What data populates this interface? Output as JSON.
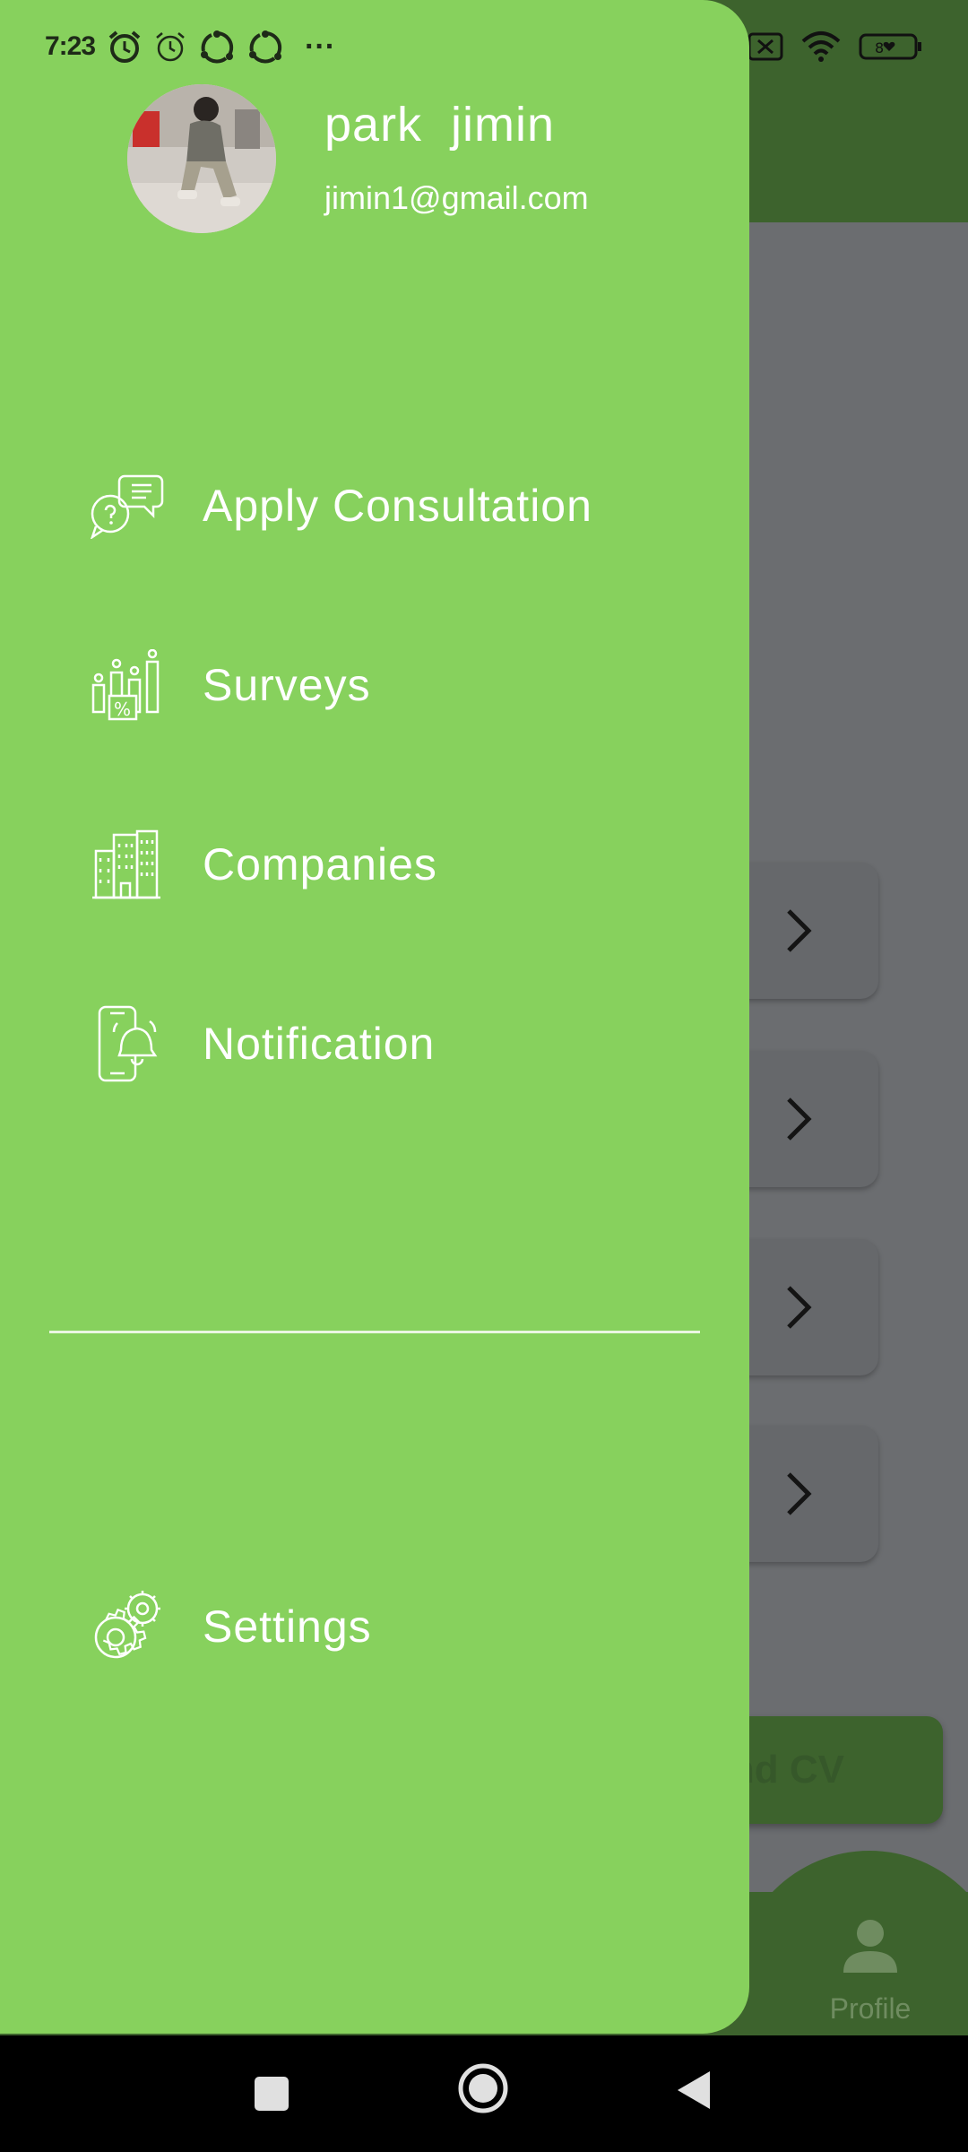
{
  "status_bar": {
    "time": "7:23",
    "more": "···",
    "battery": "80"
  },
  "drawer": {
    "user": {
      "name": "park  jimin",
      "email": "jimin1@gmail.com",
      "avatar": "user-avatar-photo"
    },
    "menu": [
      {
        "label": "Apply Consultation",
        "icon": "consultation-chat-icon"
      },
      {
        "label": "Surveys",
        "icon": "survey-chart-icon"
      },
      {
        "label": "Companies",
        "icon": "buildings-icon"
      },
      {
        "label": "Notification",
        "icon": "phone-bell-icon"
      }
    ],
    "settings": {
      "label": "Settings",
      "icon": "gears-icon"
    },
    "colors": {
      "background": "#87d15d",
      "text": "#ffffff"
    }
  },
  "background": {
    "upload_button_partial_text": "nd CV",
    "bottom_nav_profile_label": "Profile",
    "colors": {
      "header": "#3d632d",
      "scrim": "#6b6d70"
    }
  }
}
